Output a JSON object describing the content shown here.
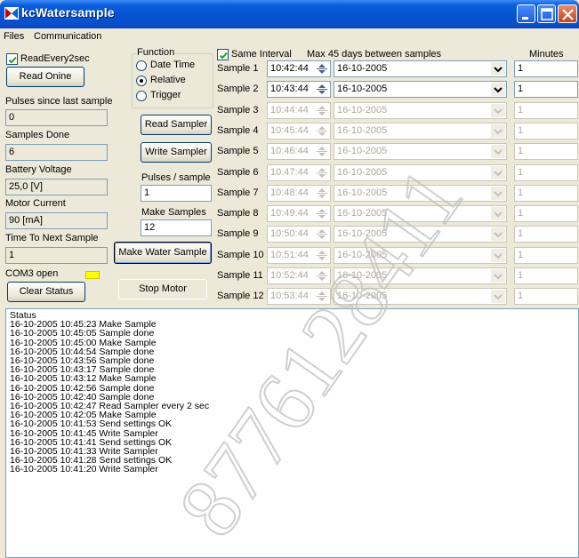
{
  "window": {
    "title": "kcWatersample"
  },
  "menu": {
    "files_label": "Files",
    "communication_label": "Communication"
  },
  "left": {
    "read_every_label": "ReadEvery2sec",
    "read_online_label": "Read Onine",
    "pulses_since_label": "Pulses since last sample",
    "pulses_since_value": "0",
    "samples_done_label": "Samples Done",
    "samples_done_value": "6",
    "battery_label": "Battery Voltage",
    "battery_value": "25,0 [V]",
    "motor_label": "Motor Current",
    "motor_value": "90 [mA]",
    "time_next_label": "Time To Next Sample",
    "time_next_value": "1",
    "com_label": "COM3 open",
    "clear_status_label": "Clear Status"
  },
  "function": {
    "group_label": "Function",
    "opt_date_time": "Date Time",
    "opt_relative": "Relative",
    "opt_trigger": "Trigger",
    "selected": "Relative",
    "read_sampler_label": "Read Sampler",
    "write_sampler_label": "Write Sampler",
    "pulses_per_sample_label": "Pulses / sample",
    "pulses_per_sample_value": "1",
    "make_samples_label": "Make Samples",
    "make_samples_value": "12",
    "make_water_sample_label": "Make Water Sample",
    "stop_motor_label": "Stop Motor"
  },
  "samples": {
    "same_interval_label": "Same Interval",
    "max_days_label": "Max 45 days between samples",
    "minutes_label": "Minutes",
    "rows": [
      {
        "label": "Sample 1",
        "time": "10:42:44",
        "date": "16-10-2005",
        "minutes": "1",
        "enabled": true
      },
      {
        "label": "Sample 2",
        "time": "10:43:44",
        "date": "16-10-2005",
        "minutes": "1",
        "enabled": true
      },
      {
        "label": "Sample 3",
        "time": "10:44:44",
        "date": "16-10-2005",
        "minutes": "1",
        "enabled": false
      },
      {
        "label": "Sample 4",
        "time": "10:45:44",
        "date": "16-10-2005",
        "minutes": "1",
        "enabled": false
      },
      {
        "label": "Sample 5",
        "time": "10:46:44",
        "date": "16-10-2005",
        "minutes": "1",
        "enabled": false
      },
      {
        "label": "Sample 6",
        "time": "10:47:44",
        "date": "16-10-2005",
        "minutes": "1",
        "enabled": false
      },
      {
        "label": "Sample 7",
        "time": "10:48:44",
        "date": "16-10-2005",
        "minutes": "1",
        "enabled": false
      },
      {
        "label": "Sample 8",
        "time": "10:49:44",
        "date": "16-10-2005",
        "minutes": "1",
        "enabled": false
      },
      {
        "label": "Sample 9",
        "time": "10:50:44",
        "date": "16-10-2005",
        "minutes": "1",
        "enabled": false
      },
      {
        "label": "Sample 10",
        "time": "10:51:44",
        "date": "16-10-2005",
        "minutes": "1",
        "enabled": false
      },
      {
        "label": "Sample 11",
        "time": "10:52:44",
        "date": "16-10-2005",
        "minutes": "1",
        "enabled": false
      },
      {
        "label": "Sample 12",
        "time": "10:53:44",
        "date": "16-10-2005",
        "minutes": "1",
        "enabled": false
      }
    ]
  },
  "status": {
    "header": "Status",
    "lines": [
      "16-10-2005 10:45:23  Make Sample",
      "16-10-2005 10:45:05  Sample done",
      "16-10-2005 10:45:00  Make Sample",
      "16-10-2005 10:44:54  Sample done",
      "16-10-2005 10:43:56  Sample done",
      "16-10-2005 10:43:17  Sample done",
      "16-10-2005 10:43:12  Make Sample",
      "16-10-2005 10:42:56  Sample done",
      "16-10-2005 10:42:40  Sample done",
      "16-10-2005 10:42:47  Read Sampler every 2 sec",
      "16-10-2005 10:42:05  Make Sample",
      "16-10-2005 10:41:53  Send settings OK",
      "16-10-2005 10:41:45  Write Sampler",
      "16-10-2005 10:41:41  Send settings OK",
      "16-10-2005 10:41:33  Write Sampler",
      "16-10-2005 10:41:28  Send settings OK",
      "16-10-2005 10:41:20  Write Sampler"
    ]
  },
  "watermark": {
    "text": "8776128411"
  },
  "colors": {
    "titlebar": "#0554d3",
    "face": "#ece9d8",
    "led": "#ffff00",
    "disabled_text": "#aca899"
  }
}
